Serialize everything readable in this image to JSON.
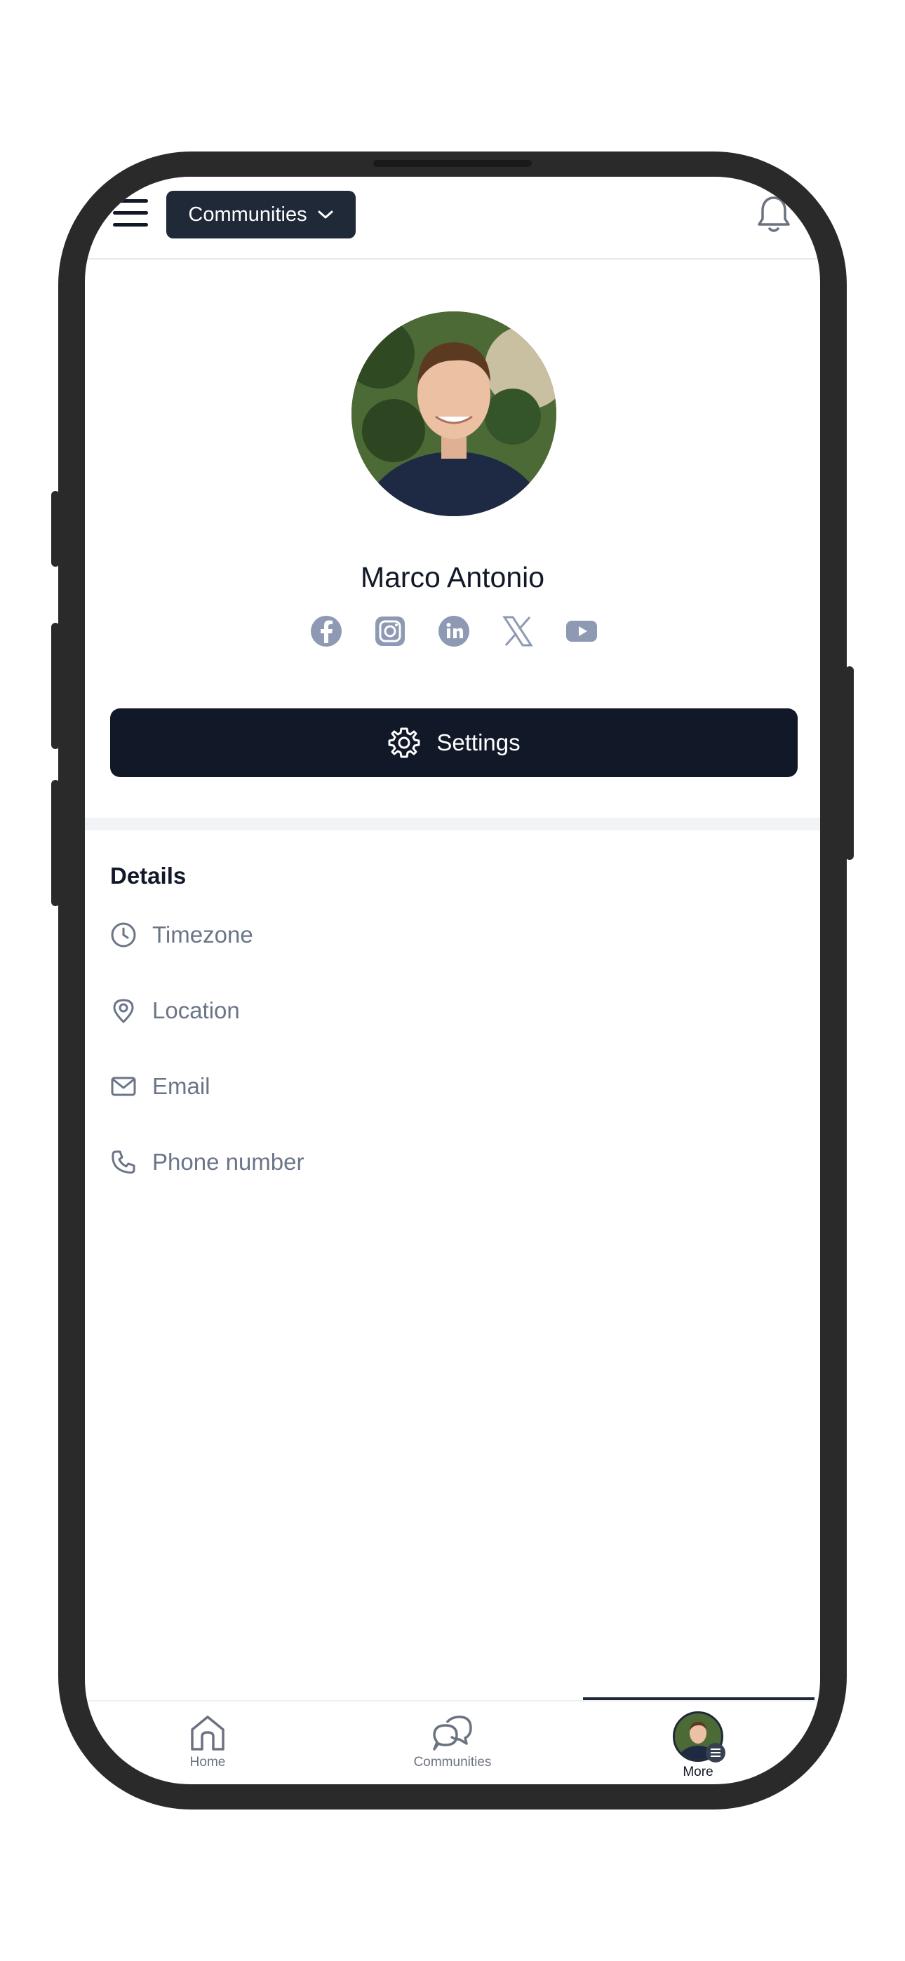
{
  "header": {
    "community_selector": "Communities"
  },
  "profile": {
    "name": "Marco Antonio",
    "socials": [
      "facebook-icon",
      "instagram-icon",
      "linkedin-icon",
      "x-icon",
      "youtube-icon"
    ],
    "settings_label": "Settings"
  },
  "details": {
    "title": "Details",
    "items": [
      {
        "icon": "clock-icon",
        "label": "Timezone"
      },
      {
        "icon": "location-pin-icon",
        "label": "Location"
      },
      {
        "icon": "mail-icon",
        "label": "Email"
      },
      {
        "icon": "phone-icon",
        "label": "Phone number"
      }
    ]
  },
  "tabbar": {
    "tabs": [
      {
        "label": "Home"
      },
      {
        "label": "Communities"
      },
      {
        "label": "More"
      }
    ]
  },
  "colors": {
    "dark": "#111827",
    "muted": "#6b7588",
    "social": "#8e9ab3"
  }
}
